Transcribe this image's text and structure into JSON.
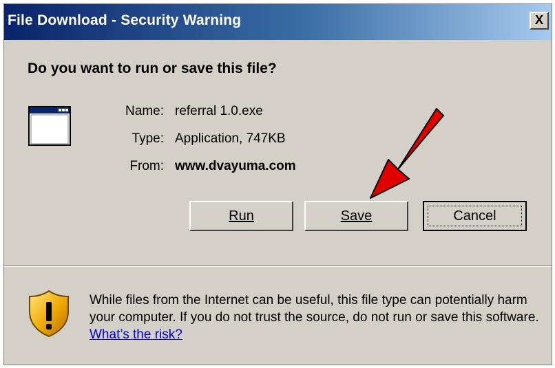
{
  "window": {
    "title": "File Download - Security Warning",
    "close_label": "X"
  },
  "question": "Do you want to run or save this file?",
  "file_info": {
    "name_label": "Name:",
    "name_value": "referral 1.0.exe",
    "type_label": "Type:",
    "type_value": "Application, 747KB",
    "from_label": "From:",
    "from_value": "www.dvayuma.com"
  },
  "buttons": {
    "run_label": "Run",
    "save_label": "Save",
    "cancel_label": "Cancel"
  },
  "warning": {
    "text": "While files from the Internet can be useful, this file type can potentially harm your computer. If you do not trust the source, do not run or save this software.",
    "link_text": "What’s the risk?"
  },
  "icons": {
    "app": "application-window-icon",
    "shield": "security-shield-warning-icon",
    "annotation": "red-arrow-annotation"
  },
  "colors": {
    "dialog_bg": "#d4d0c8",
    "titlebar_start": "#0a246a",
    "titlebar_end": "#a6caf0",
    "link": "#0000cc",
    "arrow": "#e00000"
  }
}
